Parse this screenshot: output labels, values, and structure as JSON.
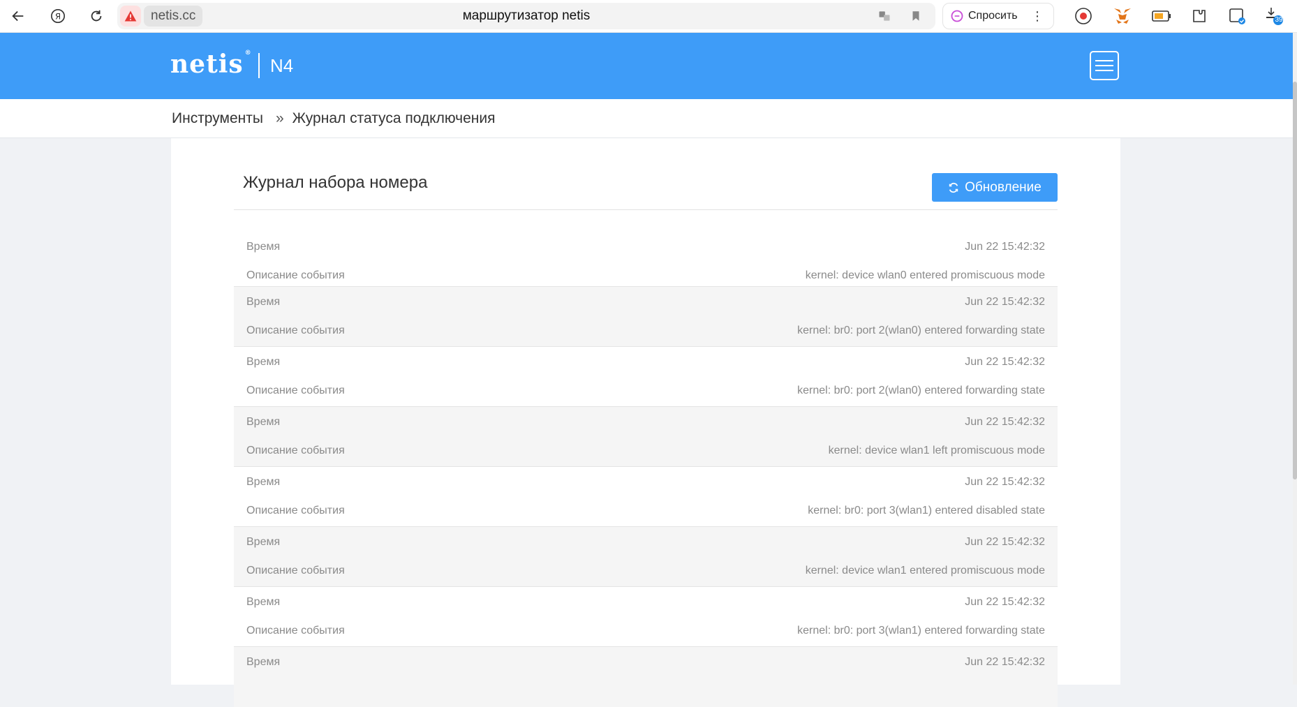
{
  "browser": {
    "url": "netis.cc",
    "tab_title": "маршрутизатор netis",
    "ask_label": "Спросить",
    "download_count": "39"
  },
  "header": {
    "logo": "netis",
    "logo_mark": "®",
    "model": "N4"
  },
  "breadcrumb": {
    "section": "Инструменты",
    "separator": "»",
    "page": "Журнал статуса подключения"
  },
  "panel": {
    "title": "Журнал набора номера",
    "refresh_label": "Обновление"
  },
  "log": {
    "time_label": "Время",
    "desc_label": "Описание события",
    "entries": [
      {
        "time": "Jun 22 15:42:32",
        "desc": "kernel: device wlan0 entered promiscuous mode"
      },
      {
        "time": "Jun 22 15:42:32",
        "desc": "kernel: br0: port 2(wlan0) entered forwarding state"
      },
      {
        "time": "Jun 22 15:42:32",
        "desc": "kernel: br0: port 2(wlan0) entered forwarding state"
      },
      {
        "time": "Jun 22 15:42:32",
        "desc": "kernel: device wlan1 left promiscuous mode"
      },
      {
        "time": "Jun 22 15:42:32",
        "desc": "kernel: br0: port 3(wlan1) entered disabled state"
      },
      {
        "time": "Jun 22 15:42:32",
        "desc": "kernel: device wlan1 entered promiscuous mode"
      },
      {
        "time": "Jun 22 15:42:32",
        "desc": "kernel: br0: port 3(wlan1) entered forwarding state"
      },
      {
        "time": "Jun 22 15:42:32",
        "desc": ""
      }
    ]
  },
  "colors": {
    "brand_blue": "#3e9cf8",
    "row_alt": "#f5f5f5",
    "text_muted": "#8a8a8a"
  },
  "icons": [
    "back-arrow-icon",
    "yandex-icon",
    "reload-icon",
    "warning-icon",
    "translate-icon",
    "bookmark-icon",
    "alice-icon",
    "more-icon",
    "record-icon",
    "metamask-icon",
    "battery-icon",
    "extension-icon",
    "tab-manager-icon",
    "download-icon",
    "refresh-icon",
    "hamburger-icon"
  ]
}
